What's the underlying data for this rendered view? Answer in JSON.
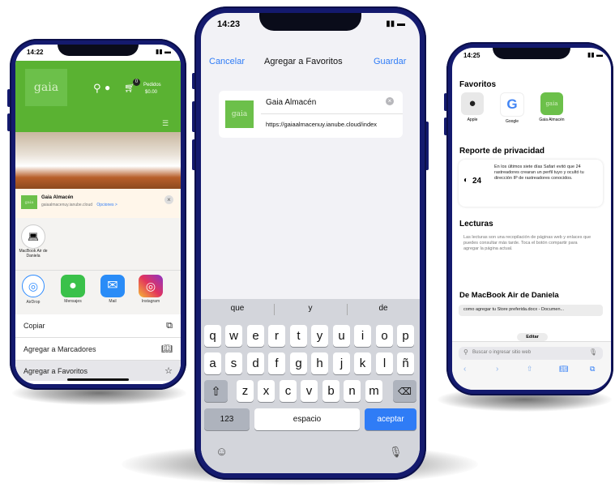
{
  "left_phone": {
    "time": "14:22",
    "logo_text": "gaia",
    "cart_label": "Pedidos",
    "cart_amount": "$0.00",
    "cart_count": "0",
    "share_title": "Gaia Almacén",
    "share_url": "gaiaalmacenuy.ianube.cloud",
    "share_options": "Opciones >",
    "airdrop_device": "MacBook Air de Daniela",
    "apps": [
      {
        "label": "AirDrop",
        "color": "#2f8cff",
        "icon": "airdrop-icon"
      },
      {
        "label": "Mensajes",
        "color": "#3ac14a",
        "icon": "messages-icon"
      },
      {
        "label": "Mail",
        "color": "#2a8cf7",
        "icon": "mail-icon"
      },
      {
        "label": "Instagram",
        "color": "#d62a7a",
        "icon": "instagram-icon"
      }
    ],
    "actions": [
      {
        "label": "Copiar",
        "icon": "copy-icon"
      },
      {
        "label": "Agregar a Marcadores",
        "icon": "book-icon"
      },
      {
        "label": "Agregar a Favoritos",
        "icon": "star-icon"
      }
    ]
  },
  "middle_phone": {
    "time": "14:23",
    "cancel": "Cancelar",
    "title": "Agregar a Favoritos",
    "save": "Guardar",
    "logo_text": "gaia",
    "name_value": "Gaia Almacén",
    "url_value": "https://gaiaalmacenuy.ianube.cloud/index",
    "suggestions": [
      "que",
      "y",
      "de"
    ],
    "row1": [
      "q",
      "w",
      "e",
      "r",
      "t",
      "y",
      "u",
      "i",
      "o",
      "p"
    ],
    "row2": [
      "a",
      "s",
      "d",
      "f",
      "g",
      "h",
      "j",
      "k",
      "l",
      "ñ"
    ],
    "row3": [
      "z",
      "x",
      "c",
      "v",
      "b",
      "n",
      "m"
    ],
    "key_123": "123",
    "key_space": "espacio",
    "key_accept": "aceptar"
  },
  "right_phone": {
    "time": "14:25",
    "favorites_title": "Favoritos",
    "favorites": [
      {
        "label": "Apple",
        "icon": "apple-icon"
      },
      {
        "label": "Google",
        "icon": "google-icon"
      },
      {
        "label": "Gaia Almacén",
        "icon": "gaia-icon"
      }
    ],
    "gaia_logo": "gaia",
    "privacy_title": "Reporte de privacidad",
    "privacy_count": "24",
    "privacy_text": "En los últimos siete días Safari evitó que 24 rastreadores crearan un perfil tuyo y ocultó tu dirección IP de rastreadores conocidos.",
    "reading_title": "Lecturas",
    "reading_text": "Las lecturas son una recopilación de páginas web y enlaces que puedes consultar más tarde. Toca el botón compartir para agregar la página actual.",
    "macbook_title": "De MacBook Air de Daniela",
    "macbook_item": "como agregar tu Store preferida.docx - Documen...",
    "edit_label": "Editar",
    "search_placeholder": "Buscar o ingresar sitio web"
  }
}
